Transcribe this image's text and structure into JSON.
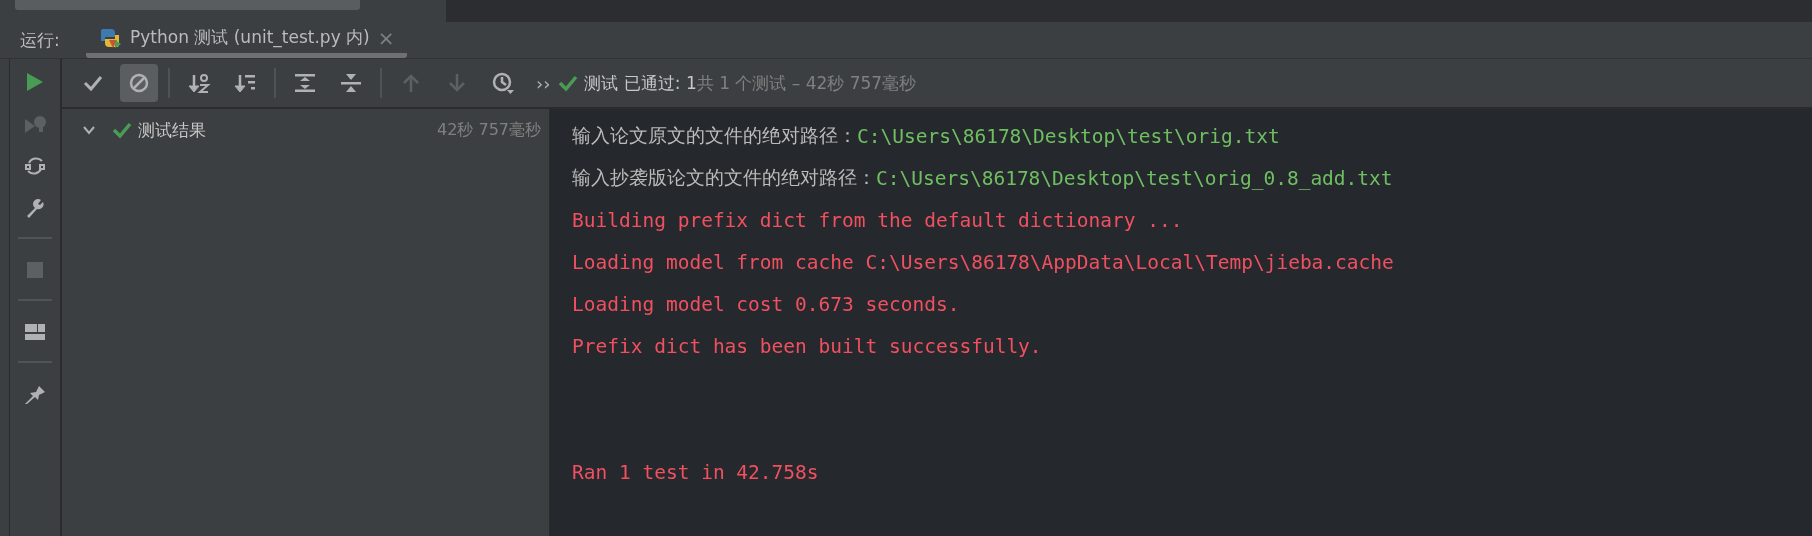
{
  "run_label": "运行:",
  "tab": {
    "title": "Python 测试 (unit_test.py 内)",
    "close": "×",
    "selected": true
  },
  "side_tools": [
    {
      "kind": "run",
      "disabled": false
    },
    {
      "kind": "rerun-failed",
      "disabled": true
    },
    {
      "kind": "autotest",
      "disabled": false
    },
    {
      "kind": "settings",
      "disabled": false
    },
    {
      "kind": "sep"
    },
    {
      "kind": "stop",
      "disabled": true
    },
    {
      "kind": "sep"
    },
    {
      "kind": "layout",
      "disabled": false
    },
    {
      "kind": "sep"
    },
    {
      "kind": "pin",
      "disabled": false
    }
  ],
  "toolbar": [
    {
      "kind": "check",
      "on": false,
      "disabled": false
    },
    {
      "kind": "ignored",
      "on": true,
      "disabled": false
    },
    {
      "kind": "sep"
    },
    {
      "kind": "sort-alpha",
      "on": false,
      "disabled": false
    },
    {
      "kind": "sort-duration",
      "on": false,
      "disabled": false
    },
    {
      "kind": "sep"
    },
    {
      "kind": "expand",
      "on": false,
      "disabled": false
    },
    {
      "kind": "collapse",
      "on": false,
      "disabled": false
    },
    {
      "kind": "sep"
    },
    {
      "kind": "up",
      "on": false,
      "disabled": true
    },
    {
      "kind": "down",
      "on": false,
      "disabled": true
    },
    {
      "kind": "history",
      "on": false,
      "disabled": false
    }
  ],
  "more": "››",
  "status": {
    "passed": "测试 已通过: 1",
    "total": "共 1 个测试 – 42秒 757毫秒"
  },
  "tree": [
    {
      "label": "测试结果",
      "time": "42秒 757毫秒",
      "expanded": true
    }
  ],
  "console": [
    {
      "kind": "input",
      "prompt": "输入论文原文的文件的绝对路径：",
      "value": "C:\\Users\\86178\\Desktop\\test\\orig.txt"
    },
    {
      "kind": "input",
      "prompt": "输入抄袭版论文的文件的绝对路径：",
      "value": "C:\\Users\\86178\\Desktop\\test\\orig_0.8_add.txt"
    },
    {
      "kind": "stderr",
      "text": "Building prefix dict from the default dictionary ..."
    },
    {
      "kind": "stderr",
      "text": "Loading model from cache C:\\Users\\86178\\AppData\\Local\\Temp\\jieba.cache"
    },
    {
      "kind": "stderr",
      "text": "Loading model cost 0.673 seconds."
    },
    {
      "kind": "stderr",
      "text": "Prefix dict has been built successfully."
    },
    {
      "kind": "blank"
    },
    {
      "kind": "blank"
    },
    {
      "kind": "stderr",
      "text": "Ran 1 test in 42.758s"
    }
  ]
}
